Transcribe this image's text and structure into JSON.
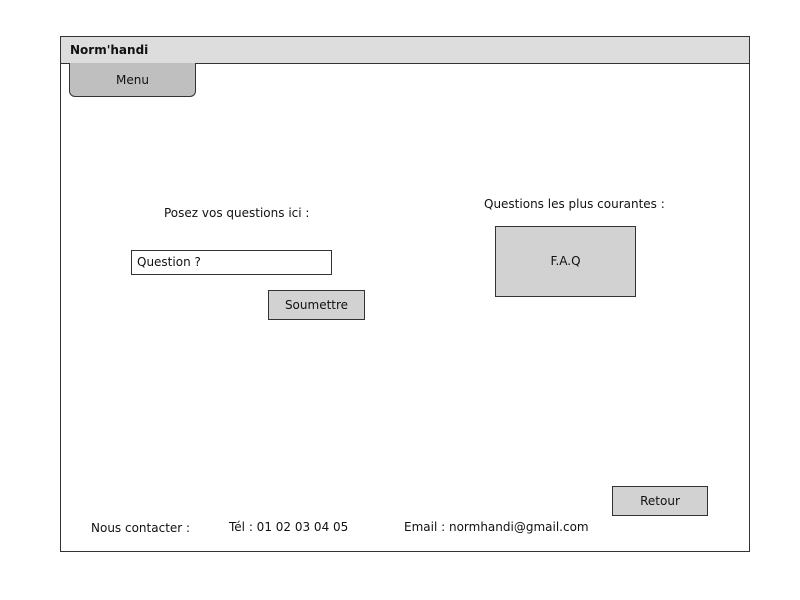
{
  "app": {
    "title": "Norm'handi"
  },
  "menu": {
    "label": "Menu"
  },
  "question_form": {
    "prompt": "Posez vos questions ici :",
    "input_value": "Question ?",
    "submit_label": "Soumettre"
  },
  "faq": {
    "heading": "Questions les plus courantes :",
    "button_label": "F.A.Q"
  },
  "footer": {
    "contact_label": "Nous contacter :",
    "phone": "Tél : 01 02 03 04 05",
    "email": "Email : normhandi@gmail.com",
    "back_label": "Retour"
  }
}
